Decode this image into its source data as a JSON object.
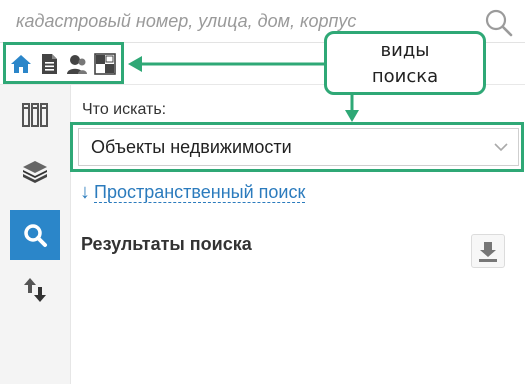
{
  "search": {
    "placeholder": "кадастровый номер, улица, дом, корпус"
  },
  "search_types": [
    {
      "name": "real-estate",
      "icon": "home-icon"
    },
    {
      "name": "documents",
      "icon": "document-icon"
    },
    {
      "name": "persons",
      "icon": "user-icon"
    },
    {
      "name": "parcels",
      "icon": "grid-icon"
    }
  ],
  "left_toolbar": [
    {
      "icon": "layers-icon"
    },
    {
      "icon": "books-icon"
    },
    {
      "icon": "search-icon",
      "active": true
    },
    {
      "icon": "transfer-arrows-icon"
    }
  ],
  "main": {
    "what_label": "Что искать:",
    "select_value": "Объекты недвижимости",
    "spatial_link": "Пространственный поиск",
    "results_title": "Результаты поиска"
  },
  "annotation": {
    "line1": "виды",
    "line2": "поиска"
  },
  "colors": {
    "accent": "#2b86c9",
    "annotation": "#2fa876",
    "link": "#2b7bbd"
  }
}
